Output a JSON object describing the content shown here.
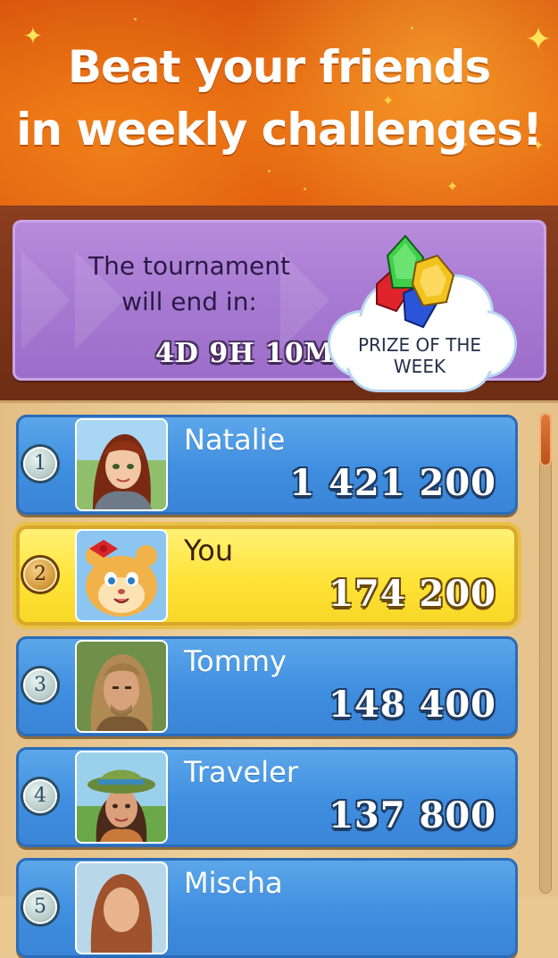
{
  "header": {
    "headline_line1": "Beat your friends",
    "headline_line2": "in weekly challenges!"
  },
  "tournament": {
    "ends_label_line1": "The tournament",
    "ends_label_line2": "will end in:",
    "timer": "4D 9H 10M",
    "prize_label_line1": "PRIZE OF THE",
    "prize_label_line2": "WEEK",
    "prize_icon": "gems-icon"
  },
  "leaderboard": {
    "rows": [
      {
        "rank": "1",
        "name": "Natalie",
        "score": "1 421 200",
        "avatar_icon": "natalie-avatar"
      },
      {
        "rank": "2",
        "name": "You",
        "score": "174 200",
        "avatar_icon": "hamster-avatar"
      },
      {
        "rank": "3",
        "name": "Tommy",
        "score": "148 400",
        "avatar_icon": "tommy-avatar"
      },
      {
        "rank": "4",
        "name": "Traveler",
        "score": "137 800",
        "avatar_icon": "traveler-avatar"
      },
      {
        "rank": "5",
        "name": "Mischa",
        "score": "",
        "avatar_icon": "mischa-avatar"
      }
    ]
  },
  "colors": {
    "header_orange": "#e3630f",
    "banner_purple": "#a77ad2",
    "row_blue": "#3f8ee0",
    "row_highlight_yellow": "#ffe338"
  }
}
